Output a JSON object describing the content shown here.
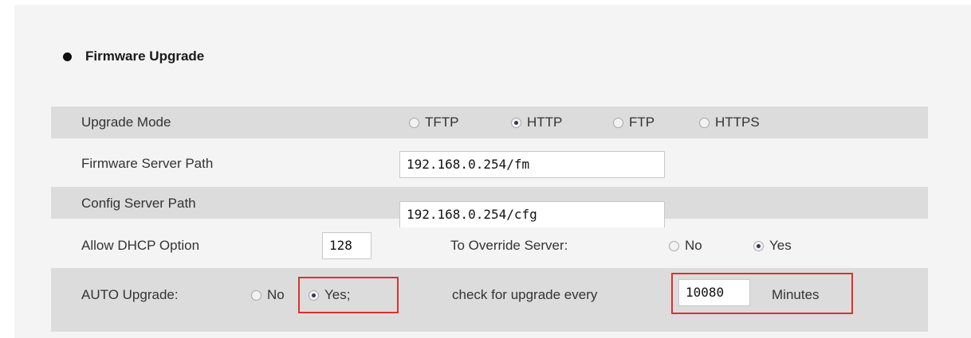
{
  "section": {
    "title": "Firmware Upgrade"
  },
  "upgrade_mode": {
    "label": "Upgrade Mode",
    "options": [
      {
        "label": "TFTP",
        "selected": false
      },
      {
        "label": "HTTP",
        "selected": true
      },
      {
        "label": "FTP",
        "selected": false
      },
      {
        "label": "HTTPS",
        "selected": false
      }
    ]
  },
  "firmware_server_path": {
    "label": "Firmware Server Path",
    "value": "192.168.0.254/fm"
  },
  "config_server_path": {
    "label": "Config Server Path",
    "value": "192.168.0.254/cfg"
  },
  "dhcp_option": {
    "label": "Allow DHCP Option",
    "value": "128",
    "override_label": "To Override Server:",
    "override_no": "No",
    "override_yes": "Yes",
    "override_selected": "Yes"
  },
  "auto_upgrade": {
    "label": "AUTO Upgrade:",
    "no": "No",
    "yes": "Yes;",
    "selected": "Yes",
    "check_label": "check for upgrade every",
    "interval_value": "10080",
    "interval_unit": "Minutes"
  },
  "colors": {
    "highlight": "#e0302c",
    "row_shade": "#dcdcdc",
    "background": "#f4f4f4"
  }
}
